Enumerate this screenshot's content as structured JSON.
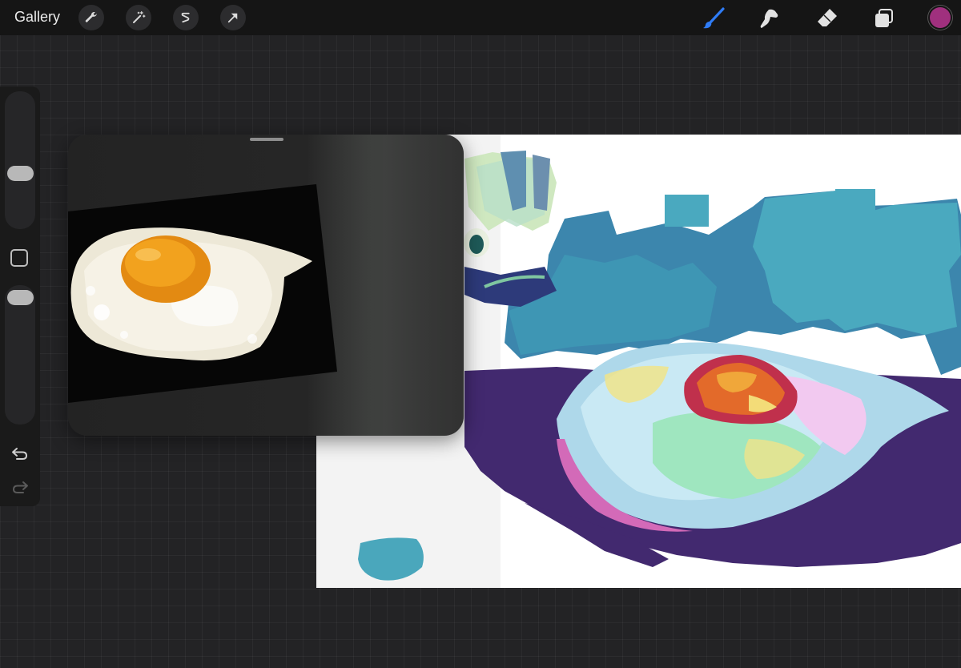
{
  "topbar": {
    "gallery_label": "Gallery",
    "left_tools": [
      "wrench-icon",
      "magic-wand-icon",
      "selection-icon",
      "transform-arrow-icon"
    ],
    "right_tools": [
      "brush-icon",
      "smudge-icon",
      "eraser-icon",
      "layers-icon"
    ],
    "active_tool": "brush-icon",
    "active_color": "#a0307e",
    "accent": "#2f7cf6"
  },
  "sidebar": {
    "controls": [
      "brush-size-slider",
      "modify-button",
      "opacity-slider",
      "undo-icon",
      "redo-icon"
    ]
  },
  "reference_window": {
    "subject": "fried-egg-photo"
  },
  "canvas": {
    "subject": "stylized-fried-egg-painting",
    "palette": [
      "#4aa7bc",
      "#3a7fa8",
      "#42296f",
      "#a0d6e8",
      "#f2c9f0",
      "#9fe6bf",
      "#e36a2a",
      "#f0e48a"
    ]
  }
}
